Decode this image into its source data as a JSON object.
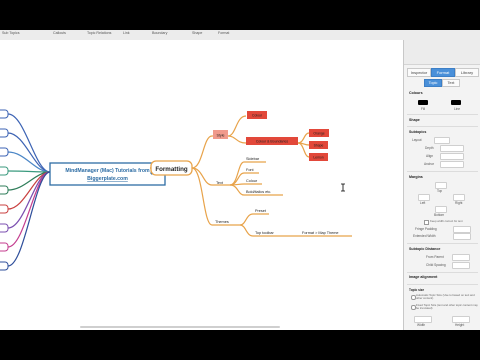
{
  "toolbar": {
    "items": [
      "Sub Topics",
      "Callouts",
      "Topic Relations",
      "Link",
      "Boundary",
      "Shape",
      "Format"
    ]
  },
  "mindmap": {
    "central_topic": [
      "MindManager (Mac) Tutorials from",
      "Biggerplate.com"
    ],
    "main_topic": "Formatting",
    "subtopics": {
      "style": "Style",
      "colour_lbl": "Colour",
      "colour_boundaries": "Colour & Boundaries",
      "orange": "Orange",
      "shape": "Shape",
      "lemon": "Lemon",
      "text": "Text",
      "sidebar": "Sidebar",
      "font": "Font",
      "colour": "Colour",
      "bold": "Bold/italics etc.",
      "themes": "Themes",
      "preset": "Preset",
      "top_toolbar": "Top toolbar",
      "format_map": "Format > Map Theme"
    }
  },
  "panel": {
    "tabs": [
      "Inspector",
      "Format",
      "Library"
    ],
    "active_tab": "Format",
    "sub_tabs": [
      "Topic",
      "Text"
    ],
    "active_sub_tab": "Topic",
    "sections": {
      "colours": "Colours",
      "fill_lbl": "Fill",
      "line_lbl": "Line",
      "shape": "Shape",
      "subtopics": "Subtopics",
      "layout_lbl": "Layout",
      "depth_lbl": "Depth",
      "align_lbl": "Align",
      "anchor_lbl": "Anchor",
      "margins": "Margins",
      "top_lbl": "Top",
      "left_lbl": "Left",
      "right_lbl": "Right",
      "bottom_lbl": "Bottom",
      "fringe_lbl": "Fringe Padding",
      "ext_width_lbl": "Extended Width",
      "subtopic_dist": "Subtopic Distance",
      "from_parent_lbl": "From Parent",
      "child_spacing_lbl": "Child Spacing",
      "image_align": "Image alignment",
      "topic_size": "Topic size",
      "auto_size": "Automatic Topic Size (Use to based on text and other content)",
      "fixed_size": "Fixed Topic Size (text and other topic content may be truncated)",
      "width_lbl": "Width",
      "height_lbl": "Height",
      "chk_lbl": "Keep width correct for text"
    }
  },
  "colors": {
    "central_border": "#2e6da4",
    "main_line": "#e8a34a",
    "orange_fill": "#f09a8c",
    "red_fill": "#e2483a",
    "accent_tab": "#4a90d9"
  }
}
